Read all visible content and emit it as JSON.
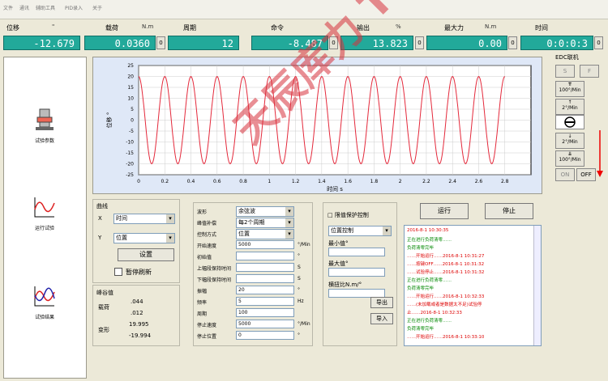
{
  "menu": [
    "文件",
    "通讯",
    "辅助工具",
    "PID录入",
    "关于"
  ],
  "readouts": [
    {
      "title": "位移",
      "unit": "\"",
      "value": "-12.679",
      "zero": "0"
    },
    {
      "title": "载荷",
      "unit": "N.m",
      "value": "0.0360",
      "zero": "0"
    },
    {
      "title": "周期",
      "unit": "",
      "value": "12",
      "zero": "0"
    },
    {
      "title": "命令",
      "unit": "",
      "value": "-8.487",
      "zero": "0"
    },
    {
      "title": "输出",
      "unit": "%",
      "value": "13.823",
      "zero": "0"
    },
    {
      "title": "最大力",
      "unit": "N.m",
      "value": "0.00",
      "zero": "0"
    },
    {
      "title": "时间",
      "unit": "",
      "value": "0:0:0:3",
      "zero": "0"
    }
  ],
  "sidebar": [
    {
      "label": "试验参数",
      "icon": "test-params-icon"
    },
    {
      "label": "运行试验",
      "icon": "run-test-icon"
    },
    {
      "label": "试验结果",
      "icon": "results-icon"
    }
  ],
  "chart_data": {
    "type": "line",
    "title": "",
    "xlabel": "时间 s",
    "ylabel": "位移 °",
    "xlim": [
      0,
      3.0
    ],
    "ylim": [
      -25,
      25
    ],
    "xticks": [
      "0",
      "0.2",
      "0.4",
      "0.6",
      "0.8",
      "1",
      "1.2",
      "1.4",
      "1.6",
      "1.8",
      "2",
      "2.2",
      "2.4",
      "2.6",
      "2.8"
    ],
    "yticks": [
      "25",
      "20",
      "15",
      "10",
      "5",
      "0",
      "-5",
      "-10",
      "-15",
      "-20",
      "-25"
    ],
    "series": [
      {
        "amplitude": 20,
        "frequency_hz": 5,
        "x_start": 0,
        "x_end": 2.8,
        "color": "#e4293b"
      }
    ],
    "grid": true
  },
  "edc": {
    "title": "EDC联机",
    "s": "S",
    "f": "F",
    "up100": "100°/Min",
    "up2": "2°/Min",
    "down2": "2°/Min",
    "down100": "100°/Min",
    "on": "ON",
    "off": "OFF"
  },
  "curve": {
    "title": "曲线",
    "x_label": "X",
    "x_value": "时间",
    "y_label": "Y",
    "y_value": "位置",
    "set_button": "设置",
    "pause_label": "暂停刷新"
  },
  "peaks": {
    "title": "峰谷值",
    "peak_label": "载荷",
    "peak_values": [
      ".044",
      ".012"
    ],
    "disp_label": "变形",
    "disp_values": [
      "19.995",
      "-19.994"
    ]
  },
  "params": {
    "rows": [
      {
        "label": "波形",
        "value": "余弦波",
        "type": "combo",
        "unit": ""
      },
      {
        "label": "峰值补偿",
        "value": "每2个周期",
        "type": "combo",
        "unit": ""
      },
      {
        "label": "控制方式",
        "value": "位置",
        "type": "combo",
        "unit": ""
      },
      {
        "label": "开始速度",
        "value": "5000",
        "type": "field",
        "unit": "°/Min"
      },
      {
        "label": "初始值",
        "value": "",
        "type": "field",
        "unit": "°"
      },
      {
        "label": "上幅段保持时间",
        "value": "",
        "type": "field",
        "unit": "S"
      },
      {
        "label": "下幅段保持时间",
        "value": "",
        "type": "field",
        "unit": "S"
      },
      {
        "label": "振幅",
        "value": "20",
        "type": "field",
        "unit": "°"
      },
      {
        "label": "频率",
        "value": "5",
        "type": "field",
        "unit": "Hz"
      },
      {
        "label": "周期",
        "value": "100",
        "type": "field",
        "unit": ""
      },
      {
        "label": "停止速度",
        "value": "5000",
        "type": "field",
        "unit": "°/Min"
      },
      {
        "label": "停止位置",
        "value": "0",
        "type": "field",
        "unit": "°"
      }
    ]
  },
  "protect": {
    "title": "□ 限值保护控制",
    "mode": "位置控制",
    "min_label": "最小值°",
    "max_label": "最大值°",
    "torque_label": "横扭比N.m/°",
    "export": "导出",
    "import": "导入"
  },
  "run_button": "运行",
  "stop_button": "停止",
  "log": [
    {
      "text": "2016-8-1  10:30:35",
      "color": "#d00"
    },
    {
      "text": "正在进行负荷清零……",
      "color": "#080"
    },
    {
      "text": "负荷清零完毕",
      "color": "#080"
    },
    {
      "text": "           ……开始运行……2016-8-1 10:31:27",
      "color": "#d00"
    },
    {
      "text": "           ……按键OFF……2016-8-1 10:31:32",
      "color": "#d00"
    },
    {
      "text": "           ……试验停止……2016-8-1 10:31:32",
      "color": "#d00"
    },
    {
      "text": "正在进行负荷清零……",
      "color": "#080"
    },
    {
      "text": "负荷清零完毕",
      "color": "#080"
    },
    {
      "text": "           ……开始运行……2016-8-1 10:32:33",
      "color": "#d00"
    },
    {
      "text": "           ……(未加载或者是数据太不足)试验停",
      "color": "#d00"
    },
    {
      "text": "止……2016-8-1 10:32:33",
      "color": "#d00"
    },
    {
      "text": "正在进行负荷清零……",
      "color": "#080"
    },
    {
      "text": "负荷清零完毕",
      "color": "#080"
    },
    {
      "text": "           ……开始运行……2016-8-1 10:33:10",
      "color": "#d00"
    }
  ],
  "watermark": "天辰库力 Tinius kuli"
}
